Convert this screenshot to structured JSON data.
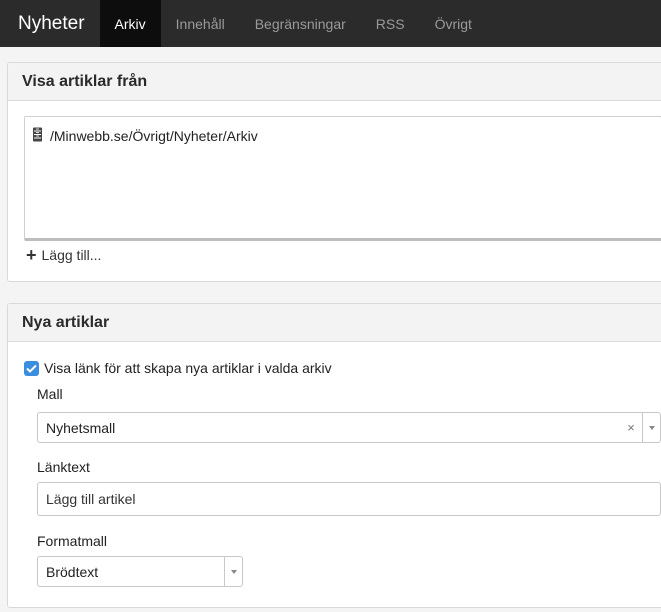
{
  "nav": {
    "brand": "Nyheter",
    "tabs": [
      {
        "label": "Arkiv",
        "active": true
      },
      {
        "label": "Innehåll",
        "active": false
      },
      {
        "label": "Begränsningar",
        "active": false
      },
      {
        "label": "RSS",
        "active": false
      },
      {
        "label": "Övrigt",
        "active": false
      }
    ]
  },
  "archive_panel": {
    "title": "Visa artiklar från",
    "items": [
      {
        "icon": "archive-icon",
        "path": "/Minwebb.se/Övrigt/Nyheter/Arkiv"
      }
    ],
    "add_label": "Lägg till..."
  },
  "new_articles_panel": {
    "title": "Nya artiklar",
    "checkbox_label": "Visa länk för att skapa nya artiklar i valda arkiv",
    "checkbox_checked": true,
    "template_label": "Mall",
    "template_value": "Nyhetsmall",
    "clear_symbol": "×",
    "link_text_label": "Länktext",
    "link_text_value": "Lägg till artikel",
    "format_label": "Formatmall",
    "format_value": "Brödtext"
  },
  "colors": {
    "nav_bg": "#2b2b2b",
    "nav_active_bg": "#0d0d0d",
    "checkbox": "#3a8ee0"
  }
}
